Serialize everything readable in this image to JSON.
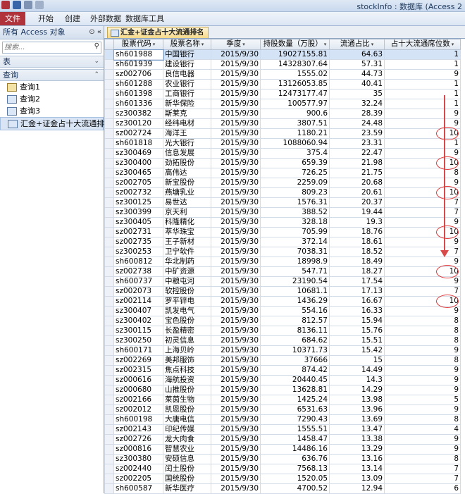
{
  "window_title": "stockInfo : 数据库 (Access 2",
  "ribbon_tabs": [
    "文件",
    "开始",
    "创建",
    "外部数据",
    "数据库工具"
  ],
  "nav": {
    "header": "所有 Access 对象",
    "search_placeholder": "搜索...",
    "group_tables": "表",
    "group_queries": "查询",
    "items": [
      "查询1",
      "查询2",
      "查询3",
      "汇金+证金占十大流通排名"
    ]
  },
  "doc_tab": "汇金+证金占十大流通排名",
  "columns": [
    "股票代码",
    "股票名称",
    "季度",
    "持股数量（万股）",
    "流通占比",
    "占十大流通席位数"
  ],
  "rows": [
    [
      "sh601988",
      "中国银行",
      "2015/9/30",
      "19027155.81",
      "64.63",
      "1"
    ],
    [
      "sh601939",
      "建设银行",
      "2015/9/30",
      "14328307.64",
      "57.31",
      "1"
    ],
    [
      "sz002706",
      "良信电器",
      "2015/9/30",
      "1555.02",
      "44.73",
      "9"
    ],
    [
      "sh601288",
      "农业银行",
      "2015/9/30",
      "13126053.85",
      "40.41",
      "1"
    ],
    [
      "sh601398",
      "工商银行",
      "2015/9/30",
      "12473177.47",
      "35",
      "1"
    ],
    [
      "sh601336",
      "新华保险",
      "2015/9/30",
      "100577.97",
      "32.24",
      "1"
    ],
    [
      "sz300382",
      "斯莱克",
      "2015/9/30",
      "900.6",
      "28.39",
      "9"
    ],
    [
      "sz300120",
      "经纬电材",
      "2015/9/30",
      "3807.51",
      "24.48",
      "9"
    ],
    [
      "sz002724",
      "海洋王",
      "2015/9/30",
      "1180.21",
      "23.59",
      "10"
    ],
    [
      "sh601818",
      "光大银行",
      "2015/9/30",
      "1088060.94",
      "23.31",
      "1"
    ],
    [
      "sz300469",
      "信息发展",
      "2015/9/30",
      "375.4",
      "22.47",
      "9"
    ],
    [
      "sz300400",
      "劲拓股份",
      "2015/9/30",
      "659.39",
      "21.98",
      "10"
    ],
    [
      "sz300465",
      "高伟达",
      "2015/9/30",
      "726.25",
      "21.75",
      "8"
    ],
    [
      "sz002705",
      "新宝股份",
      "2015/9/30",
      "2259.09",
      "20.68",
      "9"
    ],
    [
      "sz002732",
      "燕塘乳业",
      "2015/9/30",
      "809.23",
      "20.61",
      "10"
    ],
    [
      "sz300125",
      "易世达",
      "2015/9/30",
      "1576.31",
      "20.37",
      "7"
    ],
    [
      "sz300399",
      "京天利",
      "2015/9/30",
      "388.52",
      "19.44",
      "7"
    ],
    [
      "sz300405",
      "科隆精化",
      "2015/9/30",
      "328.18",
      "19.3",
      "9"
    ],
    [
      "sz002731",
      "萃华珠宝",
      "2015/9/30",
      "705.99",
      "18.76",
      "10"
    ],
    [
      "sz002735",
      "王子新材",
      "2015/9/30",
      "372.14",
      "18.61",
      "9"
    ],
    [
      "sz300253",
      "卫宁软件",
      "2015/9/30",
      "7038.31",
      "18.52",
      "7"
    ],
    [
      "sh600812",
      "华北制药",
      "2015/9/30",
      "18998.9",
      "18.49",
      "9"
    ],
    [
      "sz002738",
      "中矿资源",
      "2015/9/30",
      "547.71",
      "18.27",
      "10"
    ],
    [
      "sh600737",
      "中粮屯河",
      "2015/9/30",
      "23190.54",
      "17.54",
      "9"
    ],
    [
      "sz002073",
      "软控股份",
      "2015/9/30",
      "10681.1",
      "17.13",
      "7"
    ],
    [
      "sz002114",
      "罗平锌电",
      "2015/9/30",
      "1436.29",
      "16.67",
      "10"
    ],
    [
      "sz300407",
      "凯发电气",
      "2015/9/30",
      "554.16",
      "16.33",
      "9"
    ],
    [
      "sz300402",
      "宝色股份",
      "2015/9/30",
      "812.57",
      "15.94",
      "8"
    ],
    [
      "sz300115",
      "长盈精密",
      "2015/9/30",
      "8136.11",
      "15.76",
      "8"
    ],
    [
      "sz300250",
      "初灵信息",
      "2015/9/30",
      "684.62",
      "15.51",
      "8"
    ],
    [
      "sh600171",
      "上海贝岭",
      "2015/9/30",
      "10371.73",
      "15.42",
      "9"
    ],
    [
      "sz002269",
      "美邦服饰",
      "2015/9/30",
      "37666",
      "15",
      "8"
    ],
    [
      "sz002315",
      "焦点科技",
      "2015/9/30",
      "874.42",
      "14.49",
      "9"
    ],
    [
      "sz000616",
      "海航投资",
      "2015/9/30",
      "20440.45",
      "14.3",
      "9"
    ],
    [
      "sz000680",
      "山推股份",
      "2015/9/30",
      "13628.81",
      "14.29",
      "9"
    ],
    [
      "sz002166",
      "莱茵生物",
      "2015/9/30",
      "1425.24",
      "13.98",
      "5"
    ],
    [
      "sz002012",
      "凯恩股份",
      "2015/9/30",
      "6531.63",
      "13.96",
      "9"
    ],
    [
      "sh600198",
      "大唐电信",
      "2015/9/30",
      "7290.43",
      "13.69",
      "8"
    ],
    [
      "sz002143",
      "印纪传媒",
      "2015/9/30",
      "1555.51",
      "13.47",
      "4"
    ],
    [
      "sz002726",
      "龙大肉食",
      "2015/9/30",
      "1458.47",
      "13.38",
      "9"
    ],
    [
      "sz000816",
      "智慧农业",
      "2015/9/30",
      "14486.16",
      "13.29",
      "9"
    ],
    [
      "sz300380",
      "安硕信息",
      "2015/9/30",
      "636.76",
      "13.16",
      "8"
    ],
    [
      "sz002440",
      "闰土股份",
      "2015/9/30",
      "7568.13",
      "13.14",
      "7"
    ],
    [
      "sz002205",
      "国统股份",
      "2015/9/30",
      "1520.05",
      "13.09",
      "7"
    ],
    [
      "sh600587",
      "新华医疗",
      "2015/9/30",
      "4700.52",
      "12.94",
      "6"
    ]
  ],
  "annotation_color": "#e03a3a"
}
